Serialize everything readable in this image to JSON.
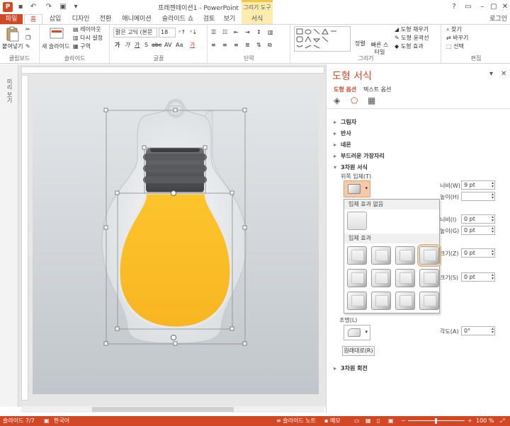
{
  "titlebar": {
    "app_icon": "P",
    "title": "프레젠테이션1 - PowerPoint",
    "context_tab": "그리기 도구",
    "buttons": [
      "?",
      "▭",
      "–",
      "▢",
      "✕"
    ]
  },
  "tabs": {
    "file": "파일",
    "home": "홈",
    "insert": "삽입",
    "design": "디자인",
    "transitions": "전환",
    "animations": "애니메이션",
    "slideshow": "슬라이드 쇼",
    "review": "검토",
    "view": "보기",
    "format": "서식",
    "signin": "로그인"
  },
  "ribbon": {
    "clipboard": {
      "paste": "붙여넣기",
      "label": "클립보드"
    },
    "slides": {
      "new_slide": "새 슬라이드",
      "layout": "레이아웃",
      "reset": "다시 설정",
      "section": "구역",
      "label": "슬라이드"
    },
    "font": {
      "font_name": "맑은 고딕 (본문",
      "font_size": "18",
      "bold": "가",
      "italic": "가",
      "underline": "가",
      "strike": "S",
      "shadow": "abc",
      "spacing": "AV",
      "case": "Aa",
      "color": "가",
      "label": "글꼴"
    },
    "paragraph": {
      "label": "단락"
    },
    "drawing": {
      "arrange": "정렬",
      "quick_styles": "빠른 스타일",
      "fill": "도형 채우기",
      "outline": "도형 윤곽선",
      "effects": "도형 효과",
      "label": "그리기"
    },
    "editing": {
      "find": "찾기",
      "replace": "바꾸기",
      "select": "선택",
      "label": "편집"
    }
  },
  "pane": {
    "title": "도형 서식",
    "tab_shape": "도형 옵션",
    "tab_text": "텍스트 옵션",
    "sections": [
      "그림자",
      "반사",
      "네온",
      "부드러운 가장자리",
      "3차원 서식",
      "3차원 회전"
    ],
    "top_bevel": "위쪽 입체(T)",
    "width_label": "너비(W)",
    "height_label": "높이(H)",
    "width_value": "9 pt",
    "height_value": "",
    "w2_label": "너비(I)",
    "h2_label": "높이(G)",
    "w2_value": "0 pt",
    "h2_value": "0 pt",
    "size_label1": "크기(Z)",
    "size_value1": "0 pt",
    "size_label2": "크기(S)",
    "size_value2": "0 pt",
    "lighting": "조명(L)",
    "angle_label": "각도(A)",
    "angle_value": "0°",
    "reset_button": "원래대로(R)"
  },
  "bevel_dropdown": {
    "no_bevel": "입체 효과 없음",
    "bevel": "입체 효과",
    "presets": [
      "둥글게",
      "각지게",
      "볼록하게",
      "슬로프",
      "동전형",
      "각진 테두리",
      "부드럽게",
      "볼록 원형",
      "예술 장식",
      "빛샘",
      "크로스",
      "디봇"
    ],
    "selected_index": 3
  },
  "thumbnails": {
    "label": "미리 보기"
  },
  "status": {
    "slide": "슬라이드 7/7",
    "language": "한국어",
    "notes": "슬라이드 노트",
    "comments": "메모",
    "zoom": "100 %"
  },
  "colors": {
    "accent": "#d24726",
    "bulb_yellow": "#fdc42b",
    "bulb_base": "#56575a",
    "context_tab": "#fcecb0"
  }
}
